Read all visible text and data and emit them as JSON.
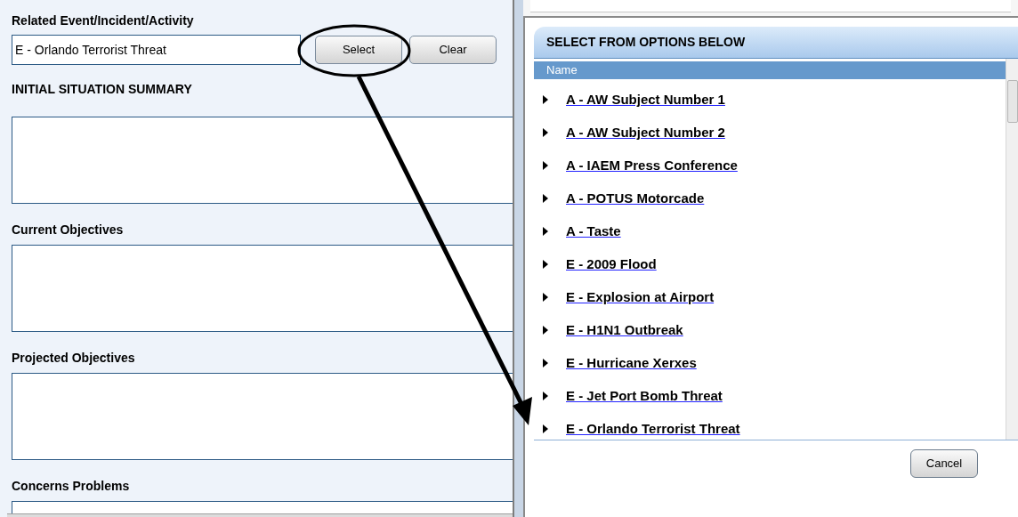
{
  "form": {
    "related_label": "Related Event/Incident/Activity",
    "related_value": "E - Orlando Terrorist Threat",
    "buttons": [
      "Select",
      "Clear"
    ],
    "section_title": "INITIAL SITUATION SUMMARY",
    "fields": [
      {
        "label": "Current Objectives"
      },
      {
        "label": "Projected Objectives"
      },
      {
        "label": "Concerns Problems"
      }
    ]
  },
  "dialog": {
    "title": "SELECT FROM OPTIONS BELOW",
    "column": "Name",
    "items": [
      {
        "label": "A - AW Subject Number 1",
        "expanded": false
      },
      {
        "label": "A - AW Subject Number 2",
        "expanded": false
      },
      {
        "label": "A - IAEM Press Conference",
        "expanded": false
      },
      {
        "label": "A - POTUS Motorcade",
        "expanded": false
      },
      {
        "label": "A - Taste",
        "expanded": false
      },
      {
        "label": "E - 2009 Flood",
        "expanded": false
      },
      {
        "label": "E - Explosion at Airport",
        "expanded": false
      },
      {
        "label": "E - H1N1 Outbreak",
        "expanded": false
      },
      {
        "label": "E - Hurricane Xerxes",
        "expanded": false
      },
      {
        "label": "E - Jet Port Bomb Threat",
        "expanded": false
      },
      {
        "label": "E - Orlando Terrorist Threat",
        "expanded": false
      }
    ],
    "buttons": [
      "Cancel"
    ]
  }
}
